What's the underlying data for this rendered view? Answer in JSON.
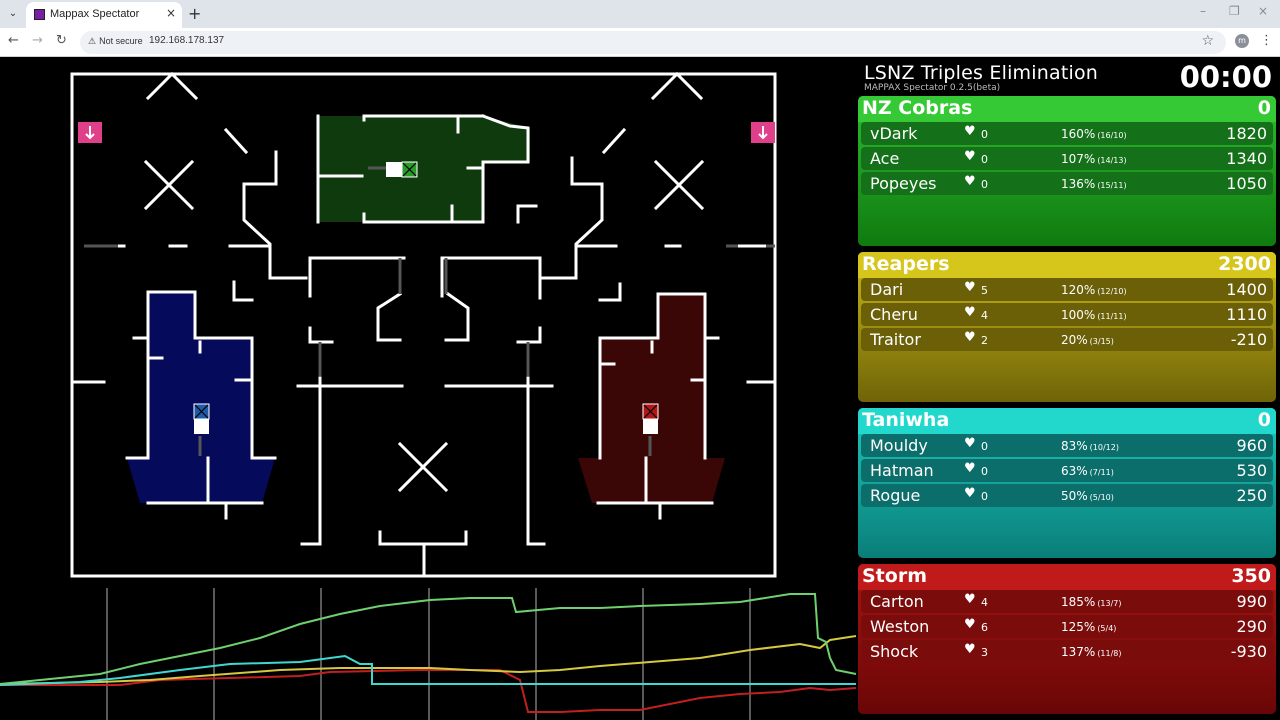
{
  "browser": {
    "tab_title": "Mappax Spectator",
    "tab_close_icon": "×",
    "new_tab_icon": "+",
    "security_label": "Not secure",
    "url": "192.168.178.137",
    "profile_initial": "m",
    "window_controls": {
      "minimize": "–",
      "restore": "❐",
      "close": "×"
    }
  },
  "header": {
    "title": "LSNZ Triples Elimination",
    "subtitle": "MAPPAX Spectator 0.2.5(beta)",
    "timer": "00:00"
  },
  "teams": [
    {
      "name": "NZ Cobras",
      "score": "0",
      "color": "#2ebd2e",
      "head_color": "#35c935",
      "bg_from": "#2ebd2e",
      "bg_to": "#0f7a0f",
      "row_color": "#15701a",
      "players": [
        {
          "name": "vDark",
          "lives": "0",
          "accuracy": "160%",
          "ratio": "(16/10)",
          "score": "1820"
        },
        {
          "name": "Ace",
          "lives": "0",
          "accuracy": "107%",
          "ratio": "(14/13)",
          "score": "1340"
        },
        {
          "name": "Popeyes",
          "lives": "0",
          "accuracy": "136%",
          "ratio": "(15/11)",
          "score": "1050"
        }
      ]
    },
    {
      "name": "Reapers",
      "score": "2300",
      "color": "#c9b818",
      "head_color": "#d6c61c",
      "bg_from": "#c9b818",
      "bg_to": "#6f6408",
      "row_color": "#6b6008",
      "players": [
        {
          "name": "Dari",
          "lives": "5",
          "accuracy": "120%",
          "ratio": "(12/10)",
          "score": "1400"
        },
        {
          "name": "Cheru",
          "lives": "4",
          "accuracy": "100%",
          "ratio": "(11/11)",
          "score": "1110"
        },
        {
          "name": "Traitor",
          "lives": "2",
          "accuracy": "20%",
          "ratio": "(3/15)",
          "score": "-210"
        }
      ]
    },
    {
      "name": "Taniwha",
      "score": "0",
      "color": "#1cc9c0",
      "head_color": "#22d8cd",
      "bg_from": "#1cc9c0",
      "bg_to": "#0a7e78",
      "row_color": "#0b6e6a",
      "players": [
        {
          "name": "Mouldy",
          "lives": "0",
          "accuracy": "83%",
          "ratio": "(10/12)",
          "score": "960"
        },
        {
          "name": "Hatman",
          "lives": "0",
          "accuracy": "63%",
          "ratio": "(7/11)",
          "score": "530"
        },
        {
          "name": "Rogue",
          "lives": "0",
          "accuracy": "50%",
          "ratio": "(5/10)",
          "score": "250"
        }
      ]
    },
    {
      "name": "Storm",
      "score": "350",
      "color": "#b81818",
      "head_color": "#c01a1a",
      "bg_from": "#a81414",
      "bg_to": "#6a0606",
      "row_color": "#7a0c0c",
      "players": [
        {
          "name": "Carton",
          "lives": "4",
          "accuracy": "185%",
          "ratio": "(13/7)",
          "score": "990"
        },
        {
          "name": "Weston",
          "lives": "6",
          "accuracy": "125%",
          "ratio": "(5/4)",
          "score": "290"
        },
        {
          "name": "Shock",
          "lives": "3",
          "accuracy": "137%",
          "ratio": "(11/8)",
          "score": "-930"
        }
      ]
    }
  ],
  "map": {
    "bases": [
      {
        "team": "NZ Cobras",
        "color": "#0e3a0e"
      },
      {
        "team": "Taniwha",
        "color": "#050a5a"
      },
      {
        "team": "Storm",
        "color": "#3a0606"
      }
    ]
  },
  "score_graph": {
    "series_colors": [
      "#6fd06f",
      "#d6c840",
      "#3fd8d0",
      "#c02020"
    ]
  }
}
